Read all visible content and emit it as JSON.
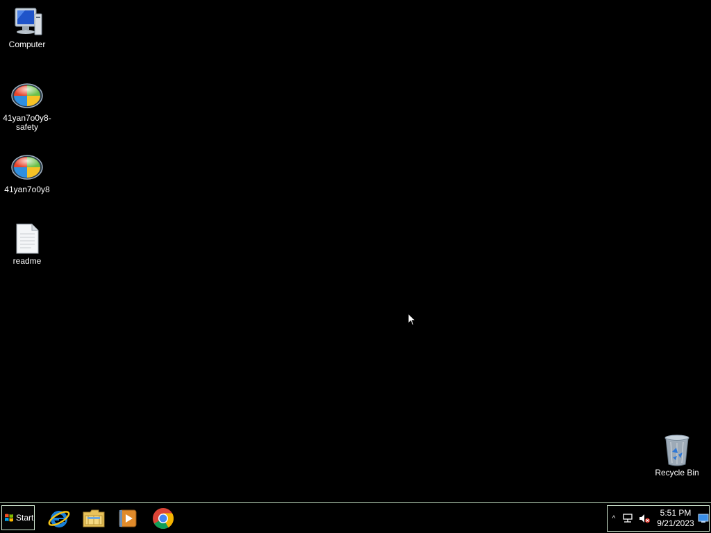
{
  "desktop": {
    "icons": [
      {
        "label": "Computer",
        "icon": "computer-icon"
      },
      {
        "label": "41yan7o0y8-safety",
        "icon": "windows-orb-icon"
      },
      {
        "label": "41yan7o0y8",
        "icon": "windows-orb-icon"
      },
      {
        "label": "readme",
        "icon": "text-file-icon"
      }
    ],
    "recycle_bin": {
      "label": "Recycle Bin",
      "icon": "recycle-bin-icon"
    }
  },
  "taskbar": {
    "start_label": "Start",
    "pinned": [
      {
        "name": "Internet Explorer",
        "icon": "internet-explorer-icon"
      },
      {
        "name": "Windows Explorer",
        "icon": "folder-icon"
      },
      {
        "name": "Windows Media Player",
        "icon": "media-player-icon"
      },
      {
        "name": "Google Chrome",
        "icon": "chrome-icon"
      }
    ],
    "tray": {
      "chevron": "^",
      "time": "5:51 PM",
      "date": "9/21/2023"
    }
  },
  "colors": {
    "desktop_background": "#000000",
    "taskbar_border": "#c8e6c8",
    "label_text": "#ffffff"
  }
}
